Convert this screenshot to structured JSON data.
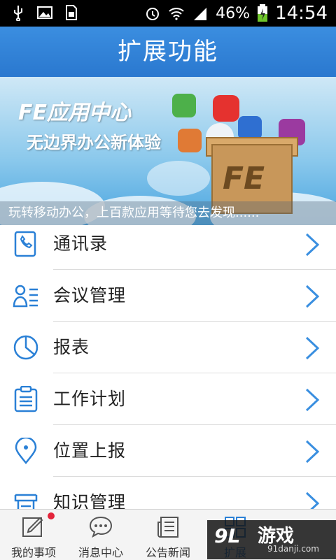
{
  "status_bar": {
    "battery": "46%",
    "time": "14:54"
  },
  "header": {
    "title": "扩展功能"
  },
  "banner": {
    "title": "FE应用中心",
    "subtitle": "无边界办公新体验",
    "box_label": "FE",
    "caption": "玩转移动办公，上百款应用等待您去发现......"
  },
  "menu": {
    "items": [
      {
        "label": "通讯录",
        "icon": "phone-book-icon"
      },
      {
        "label": "会议管理",
        "icon": "people-list-icon"
      },
      {
        "label": "报表",
        "icon": "pie-chart-icon"
      },
      {
        "label": "工作计划",
        "icon": "clipboard-icon"
      },
      {
        "label": "位置上报",
        "icon": "location-pin-icon"
      },
      {
        "label": "知识管理",
        "icon": "book-stack-icon"
      }
    ]
  },
  "tabs": [
    {
      "label": "我的事项",
      "icon": "pen-icon"
    },
    {
      "label": "消息中心",
      "icon": "chat-bubble-icon"
    },
    {
      "label": "公告新闻",
      "icon": "newspaper-icon"
    },
    {
      "label": "扩展",
      "icon": "grid-icon"
    }
  ],
  "watermark": {
    "logo": "9L",
    "main": "游戏",
    "url": "91danji.com"
  },
  "colors": {
    "accent": "#2a80d6",
    "header": "#3383d9"
  }
}
